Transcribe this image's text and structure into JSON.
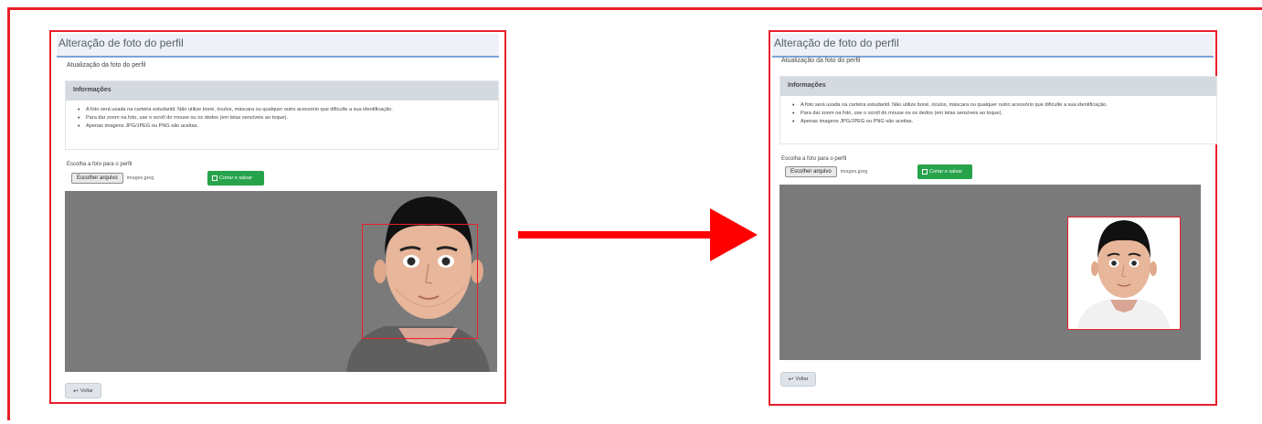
{
  "panels": [
    {
      "title": "Alteração de foto do perfil",
      "subtitle": "Atualização da foto do perfil",
      "info": {
        "heading": "Informações",
        "items": [
          "A foto será usada na carteira estudantil. Não utilize boné, óculos, máscara ou qualquer outro acessório que dificulte a sua identificação.",
          "Para dar zoom na foto, use o scroll do mouse ou os dedos (em telas sensíveis ao toque).",
          "Apenas imagens JPG/JPEG ou PNG são aceitas."
        ]
      },
      "field_label": "Escolha a foto para o perfil",
      "file_button": "Escolher arquivo",
      "file_name": "images.jpeg",
      "crop_button": "Cortar e salvar",
      "back_button": "Voltar"
    },
    {
      "title": "Alteração de foto do perfil",
      "subtitle": "Atualização da foto do perfil",
      "info": {
        "heading": "Informações",
        "items": [
          "A foto será usada na carteira estudantil. Não utilize boné, óculos, máscara ou qualquer outro acessório que dificulte a sua identificação.",
          "Para dar zoom na foto, use o scroll do mouse ou os dedos (em telas sensíveis ao toque).",
          "Apenas imagens JPG/JPEG ou PNG são aceitas."
        ]
      },
      "field_label": "Escolha a foto para o perfil",
      "file_button": "Escolher arquivo",
      "file_name": "images.jpeg",
      "crop_button": "Cortar e salvar",
      "back_button": "Voltar"
    }
  ],
  "colors": {
    "highlight": "#e8202a",
    "header_underline": "#7aa4d8",
    "crop_button": "#27a34b",
    "stage_bg": "#7a7a7a"
  },
  "icons": {
    "crop_button": "crop-icon",
    "back_button": "reply-icon",
    "arrow": "right-arrow-icon"
  }
}
